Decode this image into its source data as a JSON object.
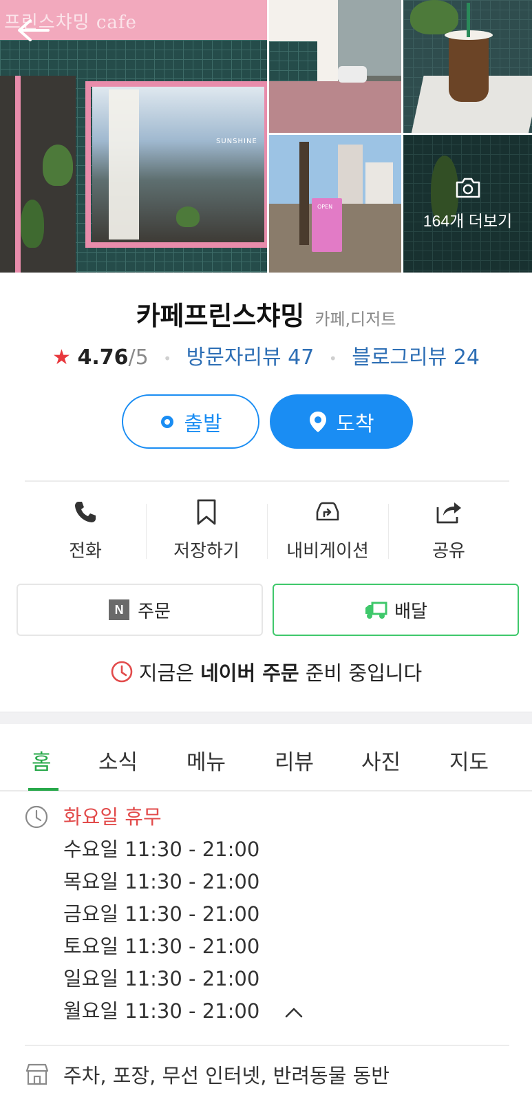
{
  "gallery": {
    "sign_text": "프린스챠밍 cafe",
    "window_text": "SUNSHINE",
    "board_text": "OPEN",
    "more_label": "164개 더보기"
  },
  "place": {
    "name": "카페프린스챠밍",
    "category": "카페,디저트",
    "rating_star": "★",
    "rating": "4.76",
    "rating_max": "/5",
    "visitor_reviews": "방문자리뷰 47",
    "blog_reviews": "블로그리뷰 24"
  },
  "route": {
    "depart_label": "출발",
    "arrive_label": "도착"
  },
  "actions": {
    "call": "전화",
    "save": "저장하기",
    "navigation": "내비게이션",
    "share": "공유"
  },
  "order": {
    "n_badge": "N",
    "order_label": "주문",
    "delivery_label": "배달"
  },
  "notice": {
    "prefix": "지금은 ",
    "bold": "네이버 주문",
    "suffix": " 준비 중입니다"
  },
  "tabs": [
    "홈",
    "소식",
    "메뉴",
    "리뷰",
    "사진",
    "지도"
  ],
  "hours": [
    "화요일 휴무",
    "수요일 11:30 - 21:00",
    "목요일 11:30 - 21:00",
    "금요일 11:30 - 21:00",
    "토요일 11:30 - 21:00",
    "일요일 11:30 - 21:00",
    "월요일 11:30 - 21:00"
  ],
  "facilities": "주차, 포장, 무선 인터넷, 반려동물 동반",
  "colors": {
    "accent_blue": "#1a8df3",
    "link_blue": "#2e6fb5",
    "active_green": "#27a84a",
    "delivery_green": "#3fc86b",
    "closed_red": "#e24b4b",
    "star_red": "#e8383d"
  }
}
